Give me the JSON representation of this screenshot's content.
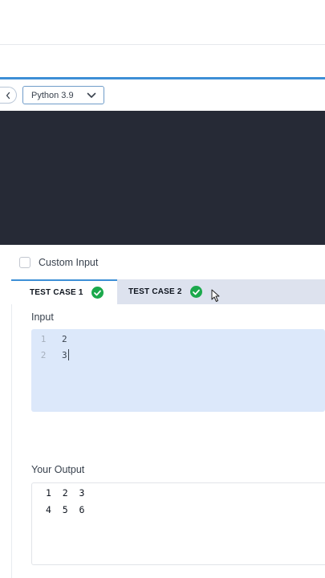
{
  "toolbar": {
    "language": "Python 3.9"
  },
  "custom_input": {
    "label": "Custom Input",
    "checked": false
  },
  "tabs": [
    {
      "label": "TEST CASE 1",
      "status": "passed",
      "active": true
    },
    {
      "label": "TEST CASE 2",
      "status": "passed",
      "active": false
    }
  ],
  "input": {
    "label": "Input",
    "lines": [
      {
        "num": "1",
        "text": "2"
      },
      {
        "num": "2",
        "text": "3"
      }
    ]
  },
  "output": {
    "label": "Your Output",
    "lines": [
      "1  2  3",
      "4  5  6"
    ]
  },
  "colors": {
    "accent": "#3d8fd6",
    "success": "#1ba94c",
    "editor_bg": "#262a36",
    "input_bg": "#dce8fa"
  }
}
